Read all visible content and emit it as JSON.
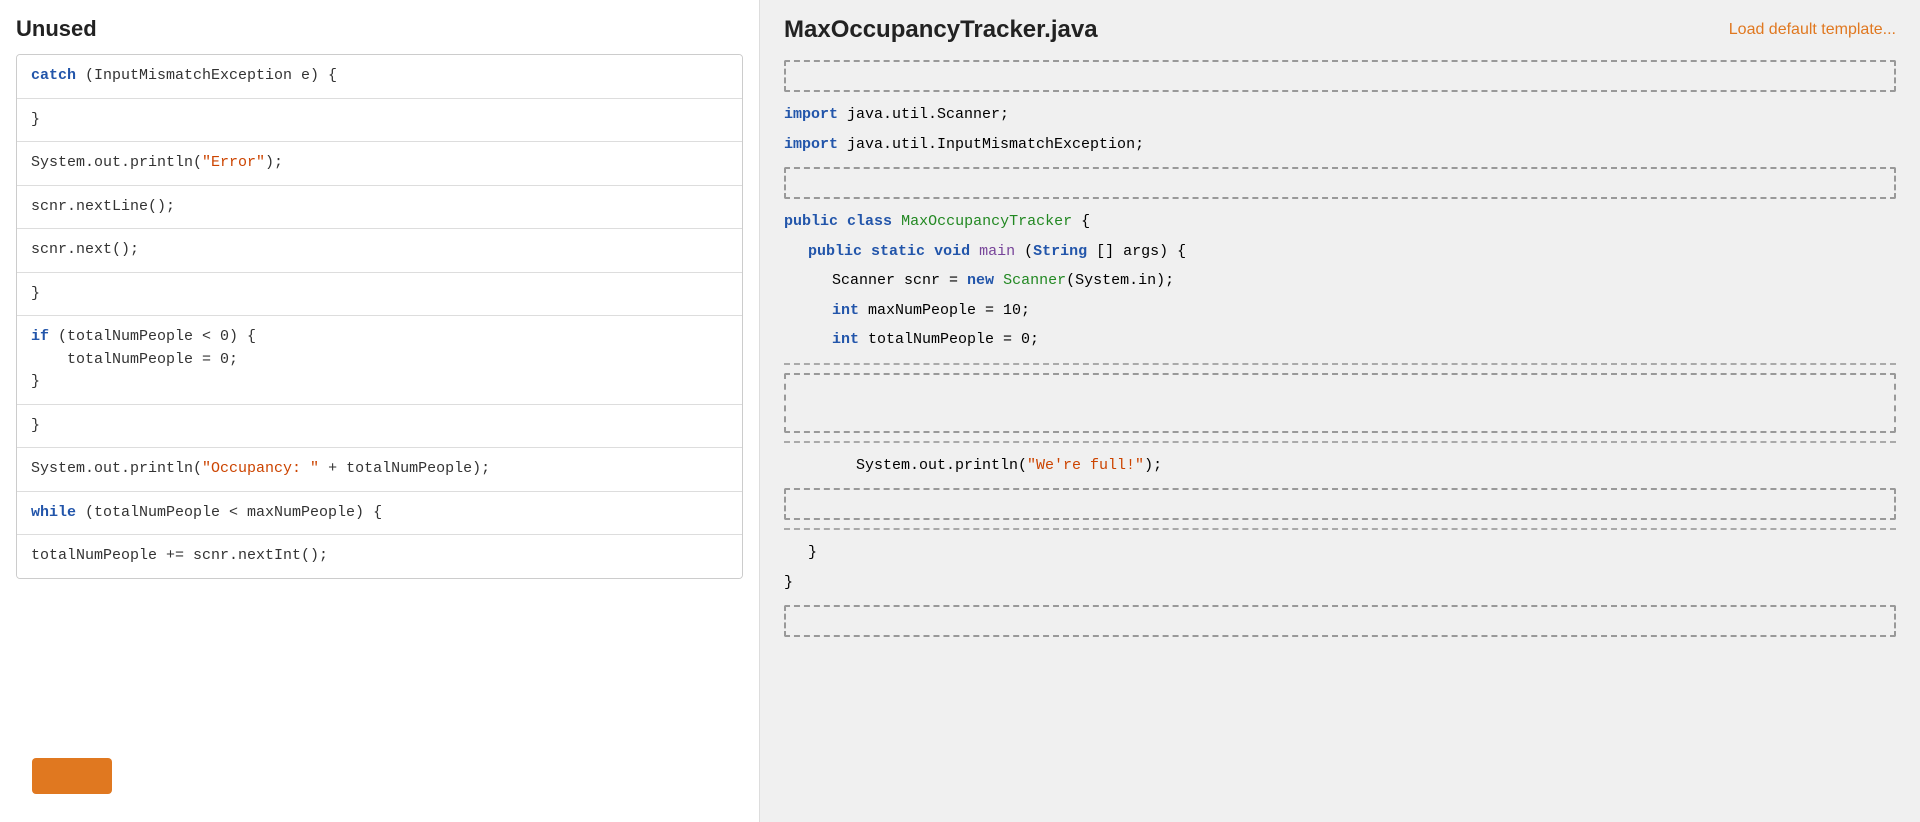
{
  "left_panel": {
    "title": "Unused",
    "items": [
      {
        "id": "item-catch",
        "html_parts": [
          {
            "type": "keyword",
            "text": "catch",
            "color": "blue"
          },
          {
            "type": "plain",
            "text": " (InputMismatchException e) {"
          }
        ]
      },
      {
        "id": "item-close-brace-1",
        "html_parts": [
          {
            "type": "plain",
            "text": "}"
          }
        ]
      },
      {
        "id": "item-system-error",
        "html_parts": [
          {
            "type": "plain",
            "text": "System.out.println("
          },
          {
            "type": "string",
            "text": "\"Error\""
          },
          {
            "type": "plain",
            "text": ");"
          }
        ]
      },
      {
        "id": "item-scnr-nextline",
        "html_parts": [
          {
            "type": "plain",
            "text": "scnr.nextLine();"
          }
        ]
      },
      {
        "id": "item-scnr-next",
        "html_parts": [
          {
            "type": "plain",
            "text": "scnr.next();"
          }
        ]
      },
      {
        "id": "item-close-brace-2",
        "html_parts": [
          {
            "type": "plain",
            "text": "}"
          }
        ]
      },
      {
        "id": "item-if",
        "html_parts": [
          {
            "type": "keyword",
            "text": "if",
            "color": "blue"
          },
          {
            "type": "plain",
            "text": " (totalNumPeople < 0) {"
          }
        ],
        "extra_lines": [
          "    totalNumPeople = 0;",
          "}"
        ]
      },
      {
        "id": "item-close-brace-3",
        "html_parts": [
          {
            "type": "plain",
            "text": "}"
          }
        ]
      },
      {
        "id": "item-system-occupancy",
        "html_parts": [
          {
            "type": "plain",
            "text": "System.out.println("
          },
          {
            "type": "string",
            "text": "\"Occupancy: \""
          },
          {
            "type": "plain",
            "text": " + totalNumPeople);"
          }
        ]
      },
      {
        "id": "item-while",
        "html_parts": [
          {
            "type": "keyword",
            "text": "while",
            "color": "blue"
          },
          {
            "type": "plain",
            "text": " (totalNumPeople < maxNumPeople) {"
          }
        ]
      },
      {
        "id": "item-total-increment",
        "html_parts": [
          {
            "type": "plain",
            "text": "totalNumPeople += scnr.nextInt();"
          }
        ]
      }
    ]
  },
  "right_panel": {
    "title": "MaxOccupancyTracker.java",
    "load_template_label": "Load default template...",
    "code_sections": {
      "imports": [
        "import java.util.Scanner;",
        "import java.util.InputMismatchException;"
      ],
      "class_declaration": "public class MaxOccupancyTracker {",
      "main_declaration": "    public static void main (String [] args) {",
      "scanner_line": "        Scanner scnr = new Scanner(System.in);",
      "max_line": "        int maxNumPeople = 10;",
      "total_line": "        int totalNumPeople = 0;",
      "println_full_line": "            System.out.println(\"We're full!\");",
      "close_inner": "    }",
      "close_outer": "}"
    }
  },
  "colors": {
    "keyword_blue": "#2255aa",
    "keyword_orange": "#cc4400",
    "string_green": "#228822",
    "link_orange": "#e07820",
    "accent_orange": "#e07820"
  }
}
